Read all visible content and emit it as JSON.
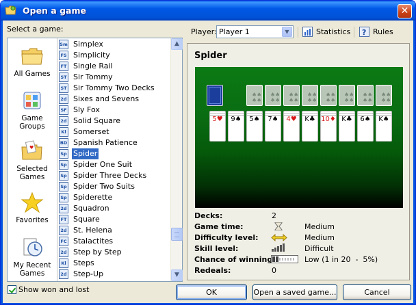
{
  "window": {
    "title": "Open a game",
    "close_glyph": "✕"
  },
  "left": {
    "select_label": "Select a game:",
    "categories": [
      {
        "label1": "All Games",
        "label2": "",
        "icon": "folder-icon"
      },
      {
        "label1": "Game",
        "label2": "Groups",
        "icon": "groups-icon"
      },
      {
        "label1": "Selected",
        "label2": "Games",
        "icon": "selected-folder-icon"
      },
      {
        "label1": "Favorites",
        "label2": "",
        "icon": "star-icon"
      },
      {
        "label1": "My Recent",
        "label2": "Games",
        "icon": "clock-icon"
      }
    ],
    "games": [
      {
        "name": "Simplex",
        "badge": "Sm"
      },
      {
        "name": "Simplicity",
        "badge": "FS"
      },
      {
        "name": "Single Rail",
        "badge": "FT"
      },
      {
        "name": "Sir Tommy",
        "badge": "ST"
      },
      {
        "name": "Sir Tommy Two Decks",
        "badge": "ST"
      },
      {
        "name": "Sixes and Sevens",
        "badge": "2d"
      },
      {
        "name": "Sly Fox",
        "badge": "SF"
      },
      {
        "name": "Solid Square",
        "badge": "2d"
      },
      {
        "name": "Somerset",
        "badge": "Kl"
      },
      {
        "name": "Spanish Patience",
        "badge": "BD"
      },
      {
        "name": "Spider",
        "badge": "Sp"
      },
      {
        "name": "Spider One Suit",
        "badge": "Sp"
      },
      {
        "name": "Spider Three Decks",
        "badge": "Sp"
      },
      {
        "name": "Spider Two Suits",
        "badge": "Sp"
      },
      {
        "name": "Spiderette",
        "badge": "Sp"
      },
      {
        "name": "Squadron",
        "badge": "2d"
      },
      {
        "name": "Square",
        "badge": "FT"
      },
      {
        "name": "St. Helena",
        "badge": "2d"
      },
      {
        "name": "Stalactites",
        "badge": "FC"
      },
      {
        "name": "Step by Step",
        "badge": "2d"
      },
      {
        "name": "Steps",
        "badge": "Kl"
      },
      {
        "name": "Step-Up",
        "badge": "2d"
      }
    ],
    "selected_game": "Spider",
    "show_won_lost_label": "Show won and lost",
    "show_won_lost_checked": true,
    "scroll_up": "▲",
    "scroll_down": "▼"
  },
  "toolbar": {
    "player_label": "Player:",
    "player_value": "Player 1",
    "statistics_label": "Statistics",
    "rules_label": "Rules",
    "dropdown_arrow": "▼"
  },
  "details": {
    "game_title": "Spider",
    "decks_label": "Decks:",
    "decks_value": "2",
    "game_time_label": "Game time:",
    "game_time_value": "Medium",
    "difficulty_label": "Difficulty level:",
    "difficulty_value": "Medium",
    "skill_label": "Skill level:",
    "skill_value": "Difficult",
    "chance_label": "Chance of winning:",
    "chance_value": "Low (1 in 20  -  5%)",
    "redeals_label": "Redeals:",
    "redeals_value": "0",
    "tableau_top": [
      "5♥",
      "9♠",
      "5♠",
      "7♠",
      "4♥",
      "K♣",
      "10♦",
      "K♣",
      "6♠",
      "K♠"
    ],
    "colors": {
      "felt_top": "#0b7a14",
      "felt_bottom": "#000000",
      "accent": "#316ac5"
    }
  },
  "buttons": {
    "ok": "OK",
    "open_saved": "Open a saved game...",
    "cancel": "Cancel"
  }
}
